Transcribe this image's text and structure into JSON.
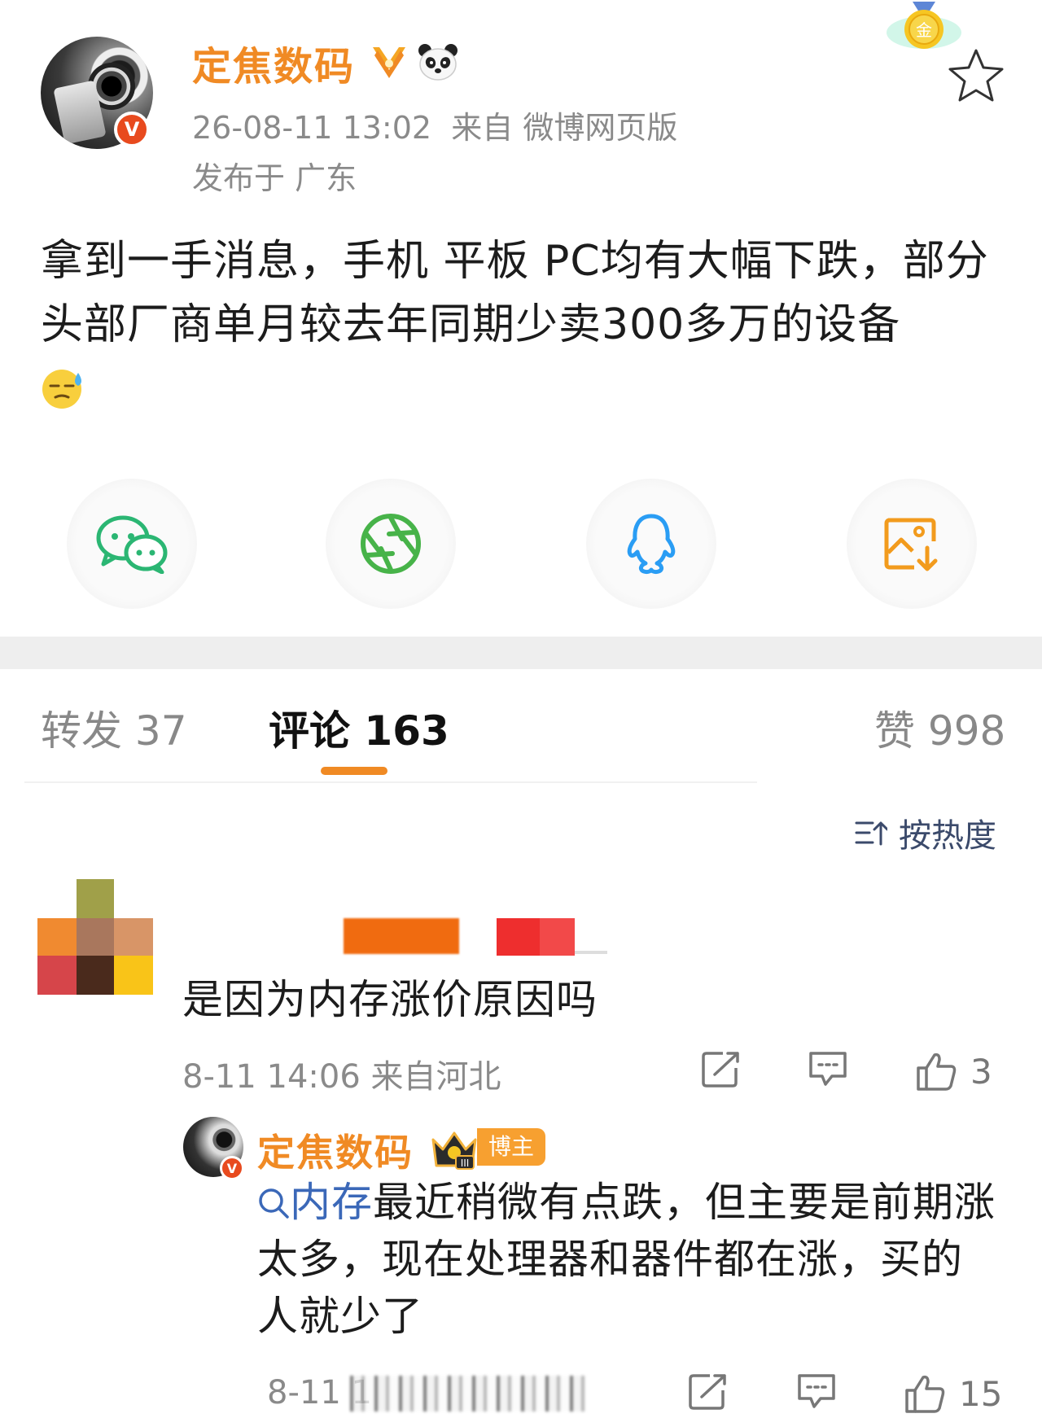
{
  "post": {
    "author": "定焦数码",
    "timestamp": "26-08-11 13:02",
    "source": "来自 微博网页版",
    "location": "发布于 广东",
    "text": "拿到一手消息，手机 平板 PC均有大幅下跌，部分头部厂商单月较去年同期少卖300多万的设备",
    "verified_badge": "V",
    "icons": [
      "sweat-emoji-icon",
      "gold-medal-icon",
      "star-icon",
      "panda-icon"
    ]
  },
  "share": {
    "items": [
      "wechat-icon",
      "moments-icon",
      "qq-icon",
      "save-image-icon"
    ]
  },
  "tabs": {
    "repost": "转发 37",
    "comments": "评论 163",
    "likes": "赞 998"
  },
  "sort": {
    "label": "按热度"
  },
  "comment": {
    "text": "是因为内存涨价原因吗",
    "meta": "8-11 14:06 来自河北",
    "like_count": "3"
  },
  "reply": {
    "author": "定焦数码",
    "badge": "博主",
    "crown_level": "III",
    "mention": "内存",
    "text": "最近稍微有点跌，但主要是前期涨太多，现在处理器和器件都在涨，买的人就少了",
    "meta_partial": "8-11 1",
    "like_count": "15"
  },
  "colors": {
    "accent_orange": "#f08a24",
    "link_blue": "#3b68b8",
    "verified_red": "#e84a1e"
  }
}
